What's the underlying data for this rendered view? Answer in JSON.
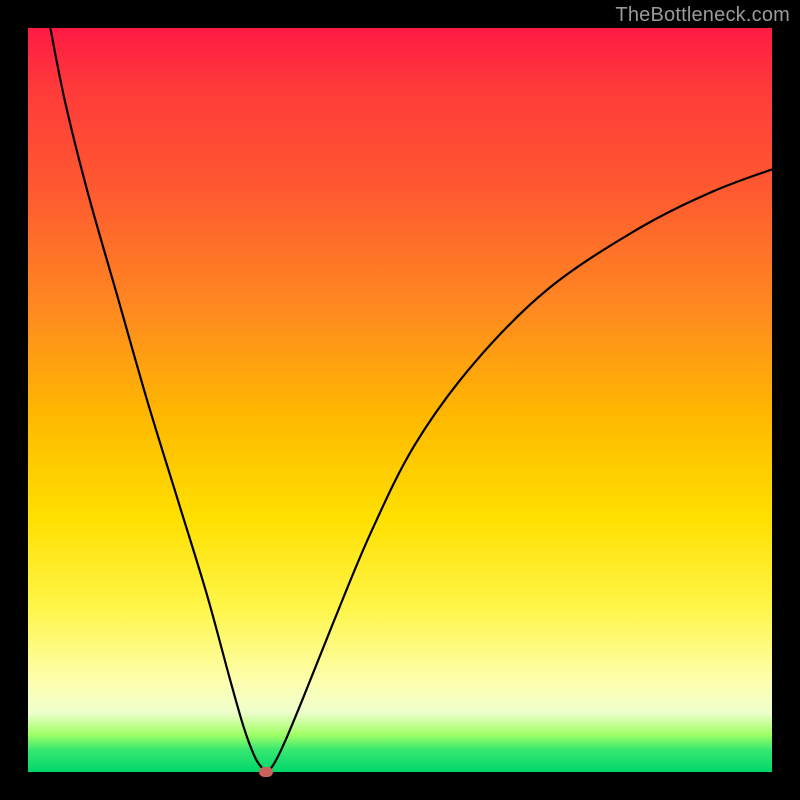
{
  "attribution": "TheBottleneck.com",
  "colors": {
    "frame": "#000000",
    "curve": "#000000",
    "marker": "#c9615c",
    "gradient_stops": [
      "#ff1a44",
      "#ff3a3a",
      "#ff5a30",
      "#ff8a20",
      "#ffb800",
      "#ffe000",
      "#fff64a",
      "#fdffb0",
      "#eeffcc",
      "#9fff66",
      "#38e870",
      "#00d66a"
    ]
  },
  "chart_data": {
    "type": "line",
    "title": "",
    "xlabel": "",
    "ylabel": "",
    "xlim": [
      0,
      100
    ],
    "ylim": [
      0,
      100
    ],
    "grid": false,
    "legend": false,
    "series": [
      {
        "name": "bottleneck-curve",
        "x": [
          3,
          5,
          8,
          12,
          16,
          20,
          24,
          27,
          29,
          30.5,
          31.5,
          32,
          33,
          34.5,
          37,
          41,
          46,
          52,
          60,
          70,
          82,
          92,
          100
        ],
        "y": [
          100,
          90,
          78,
          64,
          50,
          37,
          24,
          13,
          6,
          2,
          0.5,
          0,
          1,
          4,
          10,
          20,
          32,
          44,
          55,
          65,
          73,
          78,
          81
        ]
      }
    ],
    "annotations": [
      {
        "name": "optimal-point",
        "x": 32,
        "y": 0
      }
    ]
  }
}
